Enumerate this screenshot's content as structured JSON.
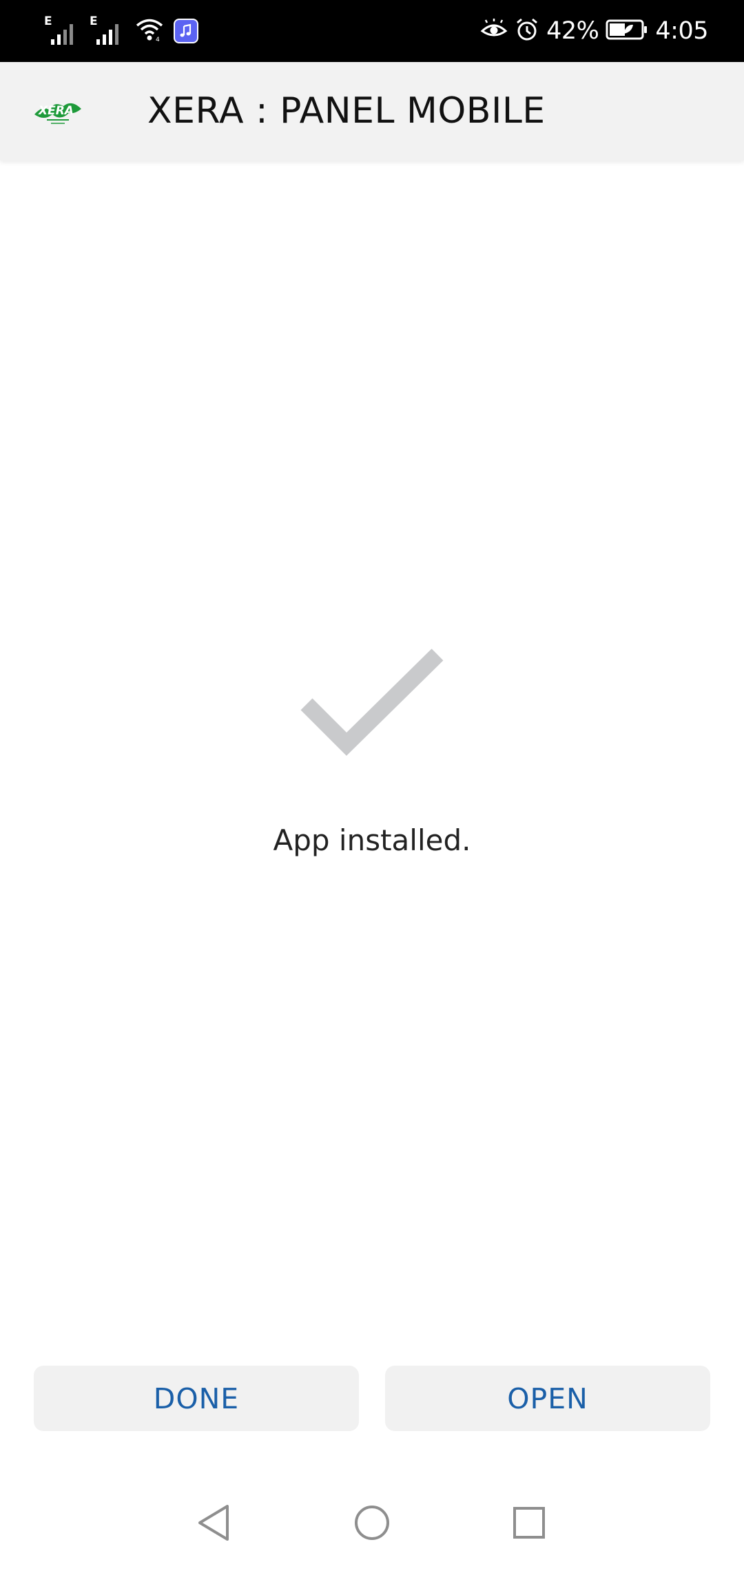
{
  "status_bar": {
    "network_type_1": "E",
    "network_type_2": "E",
    "battery_percent": "42%",
    "time": "4:05",
    "icons": [
      "signal-icon",
      "signal-icon",
      "wifi-icon",
      "music-app-icon",
      "eye-comfort-icon",
      "alarm-icon",
      "battery-icon"
    ]
  },
  "app_bar": {
    "title": "XERA : PANEL MOBILE",
    "logo_text": "XERA"
  },
  "content": {
    "status_icon": "checkmark-icon",
    "message": "App installed."
  },
  "buttons": {
    "done_label": "DONE",
    "open_label": "OPEN"
  },
  "nav_bar": {
    "icons": [
      "back-icon",
      "home-icon",
      "recents-icon"
    ]
  },
  "colors": {
    "status_bar_bg": "#000000",
    "app_bar_bg": "#f2f2f2",
    "button_bg": "#f1f1f1",
    "button_text": "#1a5fa8",
    "checkmark": "#c9cacc",
    "logo_green": "#1e9a3a"
  }
}
